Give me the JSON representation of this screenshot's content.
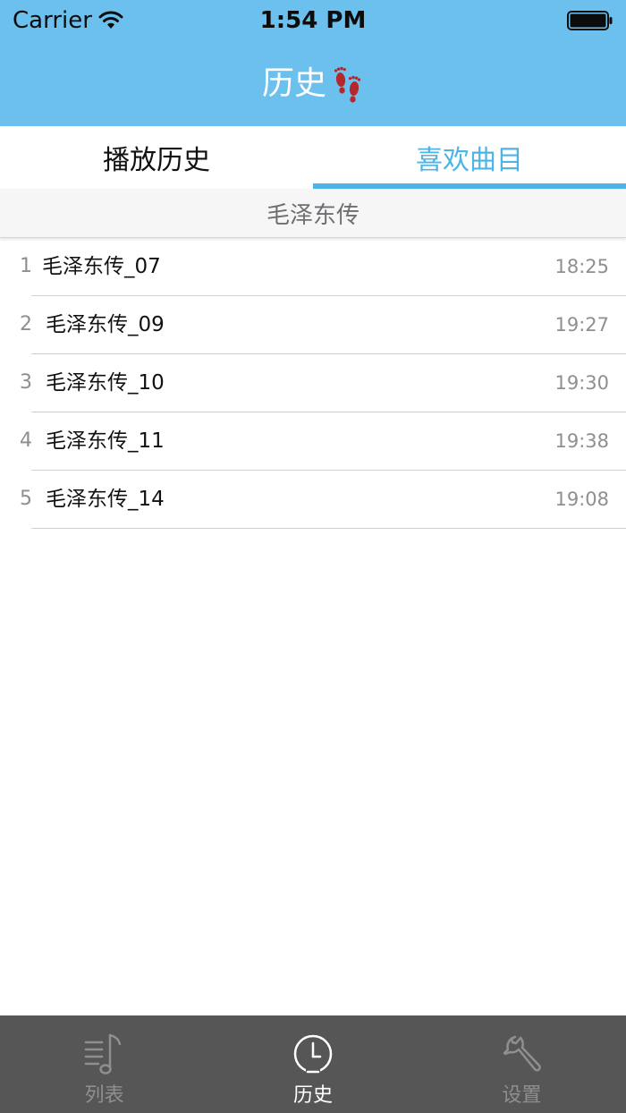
{
  "status_bar": {
    "carrier": "Carrier",
    "time": "1:54 PM"
  },
  "nav": {
    "title": "历史"
  },
  "tabs": {
    "items": [
      {
        "label": "播放历史",
        "selected": false
      },
      {
        "label": "喜欢曲目",
        "selected": true
      }
    ]
  },
  "section": {
    "title": "毛泽东传"
  },
  "list": {
    "rows": [
      {
        "index": "1",
        "name": "毛泽东传_07",
        "time": "18:25"
      },
      {
        "index": "2",
        "name": "毛泽东传_09",
        "time": "19:27"
      },
      {
        "index": "3",
        "name": "毛泽东传_10",
        "time": "19:30"
      },
      {
        "index": "4",
        "name": "毛泽东传_11",
        "time": "19:38"
      },
      {
        "index": "5",
        "name": "毛泽东传_14",
        "time": "19:08"
      }
    ]
  },
  "tab_bar": {
    "items": [
      {
        "label": "列表",
        "icon": "music-list-icon",
        "active": false
      },
      {
        "label": "历史",
        "icon": "clock-icon",
        "active": true
      },
      {
        "label": "设置",
        "icon": "wrench-icon",
        "active": false
      }
    ]
  },
  "colors": {
    "nav_background": "#6cc0ee",
    "accent": "#4cb4e6",
    "tab_bar_background": "#565656",
    "feet_icon": "#b3282d"
  }
}
